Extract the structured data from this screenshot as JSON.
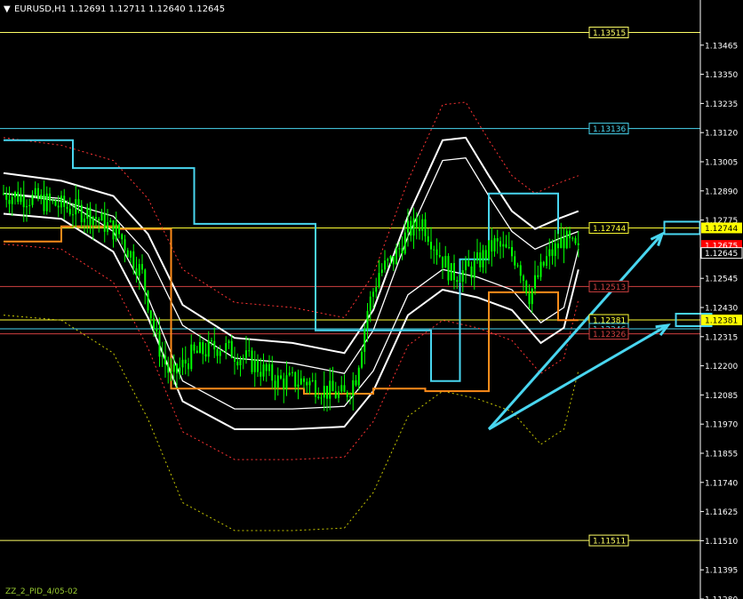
{
  "header": {
    "symbol_text": "EURUSD,H1  1.12691 1.12711 1.12640 1.12645",
    "arrow": "triangle-down-icon"
  },
  "footer": {
    "text": "ZZ_2_PID_4/05-02"
  },
  "colors": {
    "background": "#000000",
    "axis": "#ffffff",
    "candle_up": "#00ff00",
    "candle_down": "#00ff00",
    "cyan": "#49d6f0",
    "orange": "#ff8c1a",
    "yellow": "#ffff66",
    "white": "#ffffff",
    "red_dotted": "#ff3333",
    "yellow_dotted": "#c8c800"
  },
  "chart_data": {
    "type": "candlestick",
    "symbol": "EURUSD",
    "timeframe": "H1",
    "ohlc_last": {
      "open": 1.12691,
      "high": 1.12711,
      "low": 1.1264,
      "close": 1.12645
    },
    "ylim": [
      1.1128,
      1.1358
    ],
    "y_ticks": [
      "1.13465",
      "1.13350",
      "1.13235",
      "1.13120",
      "1.13005",
      "1.12890",
      "1.12775",
      "1.12660",
      "1.12545",
      "1.12430",
      "1.12315",
      "1.12200",
      "1.12085",
      "1.11970",
      "1.11855",
      "1.11740",
      "1.11625",
      "1.11510",
      "1.11395",
      "1.11280"
    ],
    "bars": 200,
    "close_path": [
      [
        0,
        1.1288
      ],
      [
        10,
        1.1286
      ],
      [
        20,
        1.1283
      ],
      [
        30,
        1.128
      ],
      [
        40,
        1.1272
      ],
      [
        48,
        1.1256
      ],
      [
        53,
        1.123
      ],
      [
        58,
        1.1215
      ],
      [
        65,
        1.1224
      ],
      [
        75,
        1.1228
      ],
      [
        85,
        1.1222
      ],
      [
        95,
        1.1214
      ],
      [
        105,
        1.1214
      ],
      [
        112,
        1.121
      ],
      [
        118,
        1.1208
      ],
      [
        122,
        1.1216
      ],
      [
        126,
        1.1242
      ],
      [
        130,
        1.1257
      ],
      [
        135,
        1.1262
      ],
      [
        140,
        1.1273
      ],
      [
        145,
        1.1277
      ],
      [
        150,
        1.1266
      ],
      [
        155,
        1.1256
      ],
      [
        162,
        1.1258
      ],
      [
        170,
        1.1268
      ],
      [
        178,
        1.1262
      ],
      [
        182,
        1.1248
      ],
      [
        188,
        1.1262
      ],
      [
        194,
        1.127
      ],
      [
        199,
        1.12645
      ]
    ],
    "horizontal_levels": [
      {
        "label": "1.13515",
        "price": 1.13515,
        "color": "#ffff66"
      },
      {
        "label": "1.13136",
        "price": 1.13136,
        "color": "#49d6f0"
      },
      {
        "label": "1.12744",
        "price": 1.12744,
        "color": "#ffff33"
      },
      {
        "label": "1.12513",
        "price": 1.12513,
        "color": "#d04040"
      },
      {
        "label": "1.12381",
        "price": 1.12381,
        "color": "#ffff33"
      },
      {
        "label": "1.12346",
        "price": 1.12346,
        "color": "#49d6f0"
      },
      {
        "label": "1.12326",
        "price": 1.12326,
        "color": "#d04040"
      },
      {
        "label": "1.11511",
        "price": 1.11511,
        "color": "#ffff66"
      }
    ],
    "right_axis_markers": [
      {
        "label": "1.12744",
        "price": 1.12744,
        "bg": "#ffff00",
        "fg": "#000000"
      },
      {
        "label": "1.12675",
        "price": 1.12675,
        "bg": "#ff0000",
        "fg": "#ffffff"
      },
      {
        "label": "1.12645",
        "price": 1.12645,
        "bg": "#000000",
        "fg": "#ffffff"
      },
      {
        "label": "1.12381",
        "price": 1.12381,
        "bg": "#ffff00",
        "fg": "#000000"
      }
    ],
    "cyan_steps": [
      [
        0,
        1.1309
      ],
      [
        24,
        1.1309
      ],
      [
        24,
        1.1298
      ],
      [
        66,
        1.1298
      ],
      [
        66,
        1.1276
      ],
      [
        108,
        1.1276
      ],
      [
        108,
        1.1234
      ],
      [
        148,
        1.1234
      ],
      [
        148,
        1.1214
      ],
      [
        158,
        1.1214
      ],
      [
        158,
        1.1262
      ],
      [
        168,
        1.1262
      ],
      [
        168,
        1.1288
      ],
      [
        180,
        1.1288
      ],
      [
        180,
        1.1288
      ],
      [
        192,
        1.1288
      ],
      [
        192,
        1.1272
      ]
    ],
    "orange_steps": [
      [
        0,
        1.1269
      ],
      [
        20,
        1.1269
      ],
      [
        20,
        1.1275
      ],
      [
        40,
        1.1275
      ],
      [
        40,
        1.1274
      ],
      [
        58,
        1.1274
      ],
      [
        58,
        1.1211
      ],
      [
        104,
        1.1211
      ],
      [
        104,
        1.1209
      ],
      [
        128,
        1.1209
      ],
      [
        128,
        1.1211
      ],
      [
        146,
        1.1211
      ],
      [
        146,
        1.121
      ],
      [
        168,
        1.121
      ],
      [
        168,
        1.1249
      ],
      [
        192,
        1.1249
      ],
      [
        192,
        1.1238
      ],
      [
        199,
        1.1238
      ]
    ],
    "white_band_upper": [
      [
        0,
        1.1296
      ],
      [
        20,
        1.1293
      ],
      [
        38,
        1.1287
      ],
      [
        50,
        1.1272
      ],
      [
        62,
        1.1244
      ],
      [
        80,
        1.1231
      ],
      [
        100,
        1.1229
      ],
      [
        118,
        1.1225
      ],
      [
        128,
        1.1242
      ],
      [
        140,
        1.1279
      ],
      [
        152,
        1.1309
      ],
      [
        160,
        1.131
      ],
      [
        168,
        1.1295
      ],
      [
        176,
        1.1281
      ],
      [
        184,
        1.1274
      ],
      [
        192,
        1.1278
      ],
      [
        199,
        1.1281
      ]
    ],
    "white_band_lower": [
      [
        0,
        1.128
      ],
      [
        20,
        1.1278
      ],
      [
        38,
        1.1265
      ],
      [
        50,
        1.1239
      ],
      [
        62,
        1.1206
      ],
      [
        80,
        1.1195
      ],
      [
        100,
        1.1195
      ],
      [
        118,
        1.1196
      ],
      [
        128,
        1.121
      ],
      [
        140,
        1.124
      ],
      [
        152,
        1.125
      ],
      [
        164,
        1.1247
      ],
      [
        176,
        1.1242
      ],
      [
        186,
        1.1229
      ],
      [
        194,
        1.1235
      ],
      [
        199,
        1.1258
      ]
    ],
    "trend_arrows": [
      {
        "from": [
          168,
          1.1195
        ],
        "to": [
          228,
          1.1272
        ]
      },
      {
        "from": [
          168,
          1.1195
        ],
        "to": [
          230,
          1.1236
        ]
      }
    ],
    "target_boxes": [
      {
        "x_bar": 230,
        "price": 1.12744
      },
      {
        "x_bar": 234,
        "price": 1.12381
      }
    ]
  }
}
